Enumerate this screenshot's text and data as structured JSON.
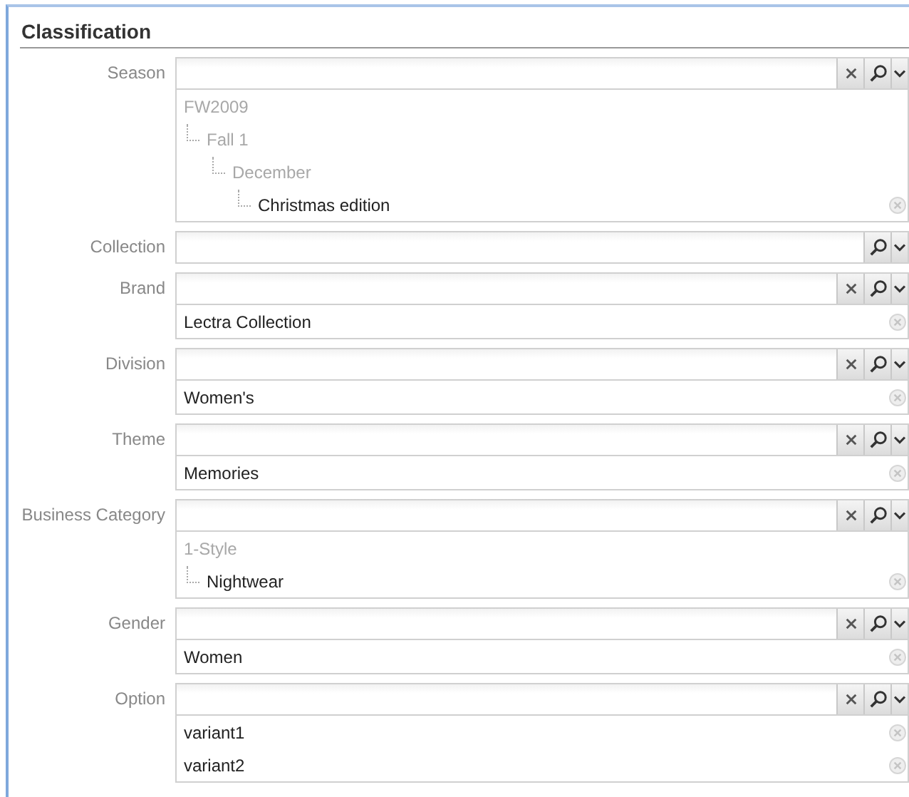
{
  "title": "Classification",
  "fields": [
    {
      "label": "Season",
      "clearable": true,
      "values": [
        {
          "text": "FW2009",
          "children": [
            {
              "text": "Fall 1",
              "children": [
                {
                  "text": "December",
                  "children": [
                    {
                      "text": "Christmas edition"
                    }
                  ]
                }
              ]
            }
          ]
        }
      ]
    },
    {
      "label": "Collection",
      "clearable": false
    },
    {
      "label": "Brand",
      "clearable": true,
      "values": [
        {
          "text": "Lectra Collection"
        }
      ]
    },
    {
      "label": "Division",
      "clearable": true,
      "values": [
        {
          "text": "Women's"
        }
      ]
    },
    {
      "label": "Theme",
      "clearable": true,
      "values": [
        {
          "text": "Memories"
        }
      ]
    },
    {
      "label": "Business Category",
      "clearable": true,
      "values": [
        {
          "text": "1-Style",
          "children": [
            {
              "text": "Nightwear"
            }
          ]
        }
      ]
    },
    {
      "label": "Gender",
      "clearable": true,
      "values": [
        {
          "text": "Women"
        }
      ]
    },
    {
      "label": "Option",
      "clearable": true,
      "values": [
        {
          "text": "variant1"
        },
        {
          "text": "variant2"
        }
      ]
    }
  ]
}
